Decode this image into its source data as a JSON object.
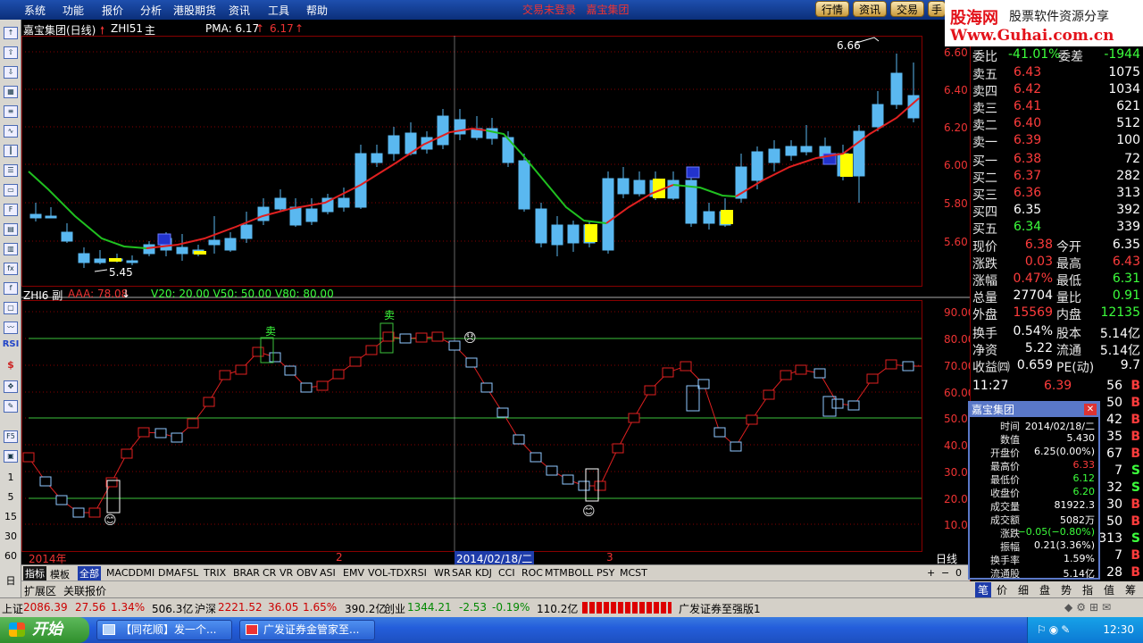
{
  "menu": [
    "系统",
    "功能",
    "报价",
    "分析",
    "港股期货",
    "资讯",
    "工具",
    "帮助"
  ],
  "menu_center": [
    "交易未登录",
    "嘉宝集团"
  ],
  "top_buttons": [
    "行情",
    "资讯",
    "交易",
    "手"
  ],
  "banner": {
    "line1": "股海网",
    "line1b": "股票软件资源分享",
    "line2": "Www.Guhai.com.cn"
  },
  "main_chart": {
    "title": "嘉宝集团(日线)",
    "indicator": "ZHI51",
    "mode": "主",
    "pma_label": "PMA: 6.17",
    "pma_val2": "6.17",
    "high_mark": "6.66",
    "low_mark": "5.45",
    "price_axis": [
      "6.60",
      "6.40",
      "6.20",
      "6.00",
      "5.80",
      "5.60"
    ]
  },
  "sub_chart": {
    "title": "ZHI6 副",
    "aaa": "AAA: 78.08",
    "levels": "V20: 20.00 V50: 50.00 V80: 80.00",
    "axis": [
      "90.00",
      "80.00",
      "70.00",
      "60.00",
      "50.00",
      "40.00",
      "30.00",
      "20.00",
      "10.00"
    ],
    "sell_label": "卖",
    "cursor_date": "2014/02/18/二",
    "x_labels": [
      "2014年",
      "2",
      "3"
    ],
    "period": "日线"
  },
  "left_numbers": [
    "1",
    "5",
    "15",
    "30",
    "60",
    "日"
  ],
  "left_marks": [
    "RSI",
    "$"
  ],
  "indicator_tabs": [
    "指标",
    "模板",
    "全部",
    "MACD",
    "DMI",
    "DMA",
    "FSL",
    "TRIX",
    "BRAR",
    "CR",
    "VR",
    "OBV",
    "ASI",
    "EMV",
    "VOL-TDX",
    "RSI",
    "WR",
    "SAR",
    "KDJ",
    "CCI",
    "ROC",
    "MTM",
    "BOLL",
    "PSY",
    "MCST"
  ],
  "ext_tabs": [
    "扩展区",
    "关联报价"
  ],
  "pager": [
    "+",
    "−",
    "0"
  ],
  "order_book": {
    "ratio_label": "委比",
    "ratio": "-41.01%",
    "diff_label": "委差",
    "diff": "-1944",
    "asks": [
      {
        "l": "卖五",
        "p": "6.43",
        "v": "1075"
      },
      {
        "l": "卖四",
        "p": "6.42",
        "v": "1034"
      },
      {
        "l": "卖三",
        "p": "6.41",
        "v": "621"
      },
      {
        "l": "卖二",
        "p": "6.40",
        "v": "512"
      },
      {
        "l": "卖一",
        "p": "6.39",
        "v": "100"
      }
    ],
    "bids": [
      {
        "l": "买一",
        "p": "6.38",
        "v": "72"
      },
      {
        "l": "买二",
        "p": "6.37",
        "v": "282"
      },
      {
        "l": "买三",
        "p": "6.36",
        "v": "313"
      },
      {
        "l": "买四",
        "p": "6.35",
        "v": "392"
      },
      {
        "l": "买五",
        "p": "6.34",
        "v": "339"
      }
    ]
  },
  "quote": [
    {
      "a": "现价",
      "av": "6.38",
      "ac": "red",
      "b": "今开",
      "bv": "6.35",
      "bc": "white"
    },
    {
      "a": "涨跌",
      "av": "0.03",
      "ac": "red",
      "b": "最高",
      "bv": "6.43",
      "bc": "red"
    },
    {
      "a": "涨幅",
      "av": "0.47%",
      "ac": "red",
      "b": "最低",
      "bv": "6.31",
      "bc": "green"
    },
    {
      "a": "总量",
      "av": "27704",
      "ac": "white",
      "b": "量比",
      "bv": "0.91",
      "bc": "green"
    },
    {
      "a": "外盘",
      "av": "15569",
      "ac": "red",
      "b": "内盘",
      "bv": "12135",
      "bc": "green"
    }
  ],
  "quote2": [
    {
      "a": "换手",
      "av": "0.54%",
      "b": "股本",
      "bv": "5.14亿"
    },
    {
      "a": "净资",
      "av": "5.22",
      "b": "流通",
      "bv": "5.14亿"
    },
    {
      "a": "收益㈣",
      "av": "0.659",
      "b": "PE(动)",
      "bv": "9.7"
    }
  ],
  "ticks": [
    {
      "t": "11:27",
      "p": "6.39",
      "v": "56",
      "d": "B"
    },
    {
      "t": "",
      "p": "",
      "v": "50",
      "d": "B"
    },
    {
      "t": "",
      "p": "",
      "v": "42",
      "d": "B"
    },
    {
      "t": "",
      "p": "",
      "v": "35",
      "d": "B"
    },
    {
      "t": "",
      "p": "",
      "v": "67",
      "d": "B"
    },
    {
      "t": "",
      "p": "",
      "v": "7",
      "d": "S"
    },
    {
      "t": "",
      "p": "",
      "v": "32",
      "d": "S"
    },
    {
      "t": "",
      "p": "",
      "v": "30",
      "d": "B"
    },
    {
      "t": "",
      "p": "",
      "v": "50",
      "d": "B"
    },
    {
      "t": "",
      "p": "",
      "v": "313",
      "d": "S"
    },
    {
      "t": "",
      "p": "",
      "v": "7",
      "d": "B"
    },
    {
      "t": "",
      "p": "",
      "v": "28",
      "d": "B"
    }
  ],
  "popup": {
    "title": "嘉宝集团",
    "rows": [
      {
        "k": "时间",
        "v": "2014/02/18/二",
        "c": "white"
      },
      {
        "k": "数值",
        "v": "5.430",
        "c": "white"
      },
      {
        "k": "开盘价",
        "v": "6.25(0.00%)",
        "c": "white"
      },
      {
        "k": "最高价",
        "v": "6.33",
        "c": "red"
      },
      {
        "k": "最低价",
        "v": "6.12",
        "c": "green"
      },
      {
        "k": "收盘价",
        "v": "6.20",
        "c": "green"
      },
      {
        "k": "成交量",
        "v": "81922.3",
        "c": "white"
      },
      {
        "k": "成交额",
        "v": "5082万",
        "c": "white"
      },
      {
        "k": "涨跌",
        "v": "−0.05(−0.80%)",
        "c": "green"
      },
      {
        "k": "振幅",
        "v": "0.21(3.36%)",
        "c": "white"
      },
      {
        "k": "换手率",
        "v": "1.59%",
        "c": "white"
      },
      {
        "k": "流通股",
        "v": "5.14亿",
        "c": "white"
      }
    ]
  },
  "right_tabs": [
    "笔",
    "价",
    "细",
    "盘",
    "势",
    "指",
    "值",
    "筹"
  ],
  "status": {
    "sh_label": "上证",
    "sh": "2086.39",
    "sh_chg": "27.56",
    "sh_pct": "1.34%",
    "sh_amt": "506.3亿",
    "hs_label": "沪深",
    "hs": "2221.52",
    "hs_chg": "36.05",
    "hs_pct": "1.65%",
    "hs_amt": "390.2亿",
    "cy_label": "创业",
    "cy": "1344.21",
    "cy_chg": "-2.53",
    "cy_pct": "-0.19%",
    "cy_amt": "110.2亿",
    "broker": "广发证券至强版1"
  },
  "taskbar": {
    "start": "开始",
    "tasks": [
      "【同花顺】发一个...",
      "广发证券金管家至..."
    ],
    "clock": "12:30"
  },
  "colors": {
    "up": "#ff3c3c",
    "down": "#3cff3c",
    "candle_up": "#e03030",
    "candle_down": "#5ab8f0",
    "ma_up": "#e02020",
    "ma_down": "#20c020",
    "yellow": "#ffff00"
  }
}
